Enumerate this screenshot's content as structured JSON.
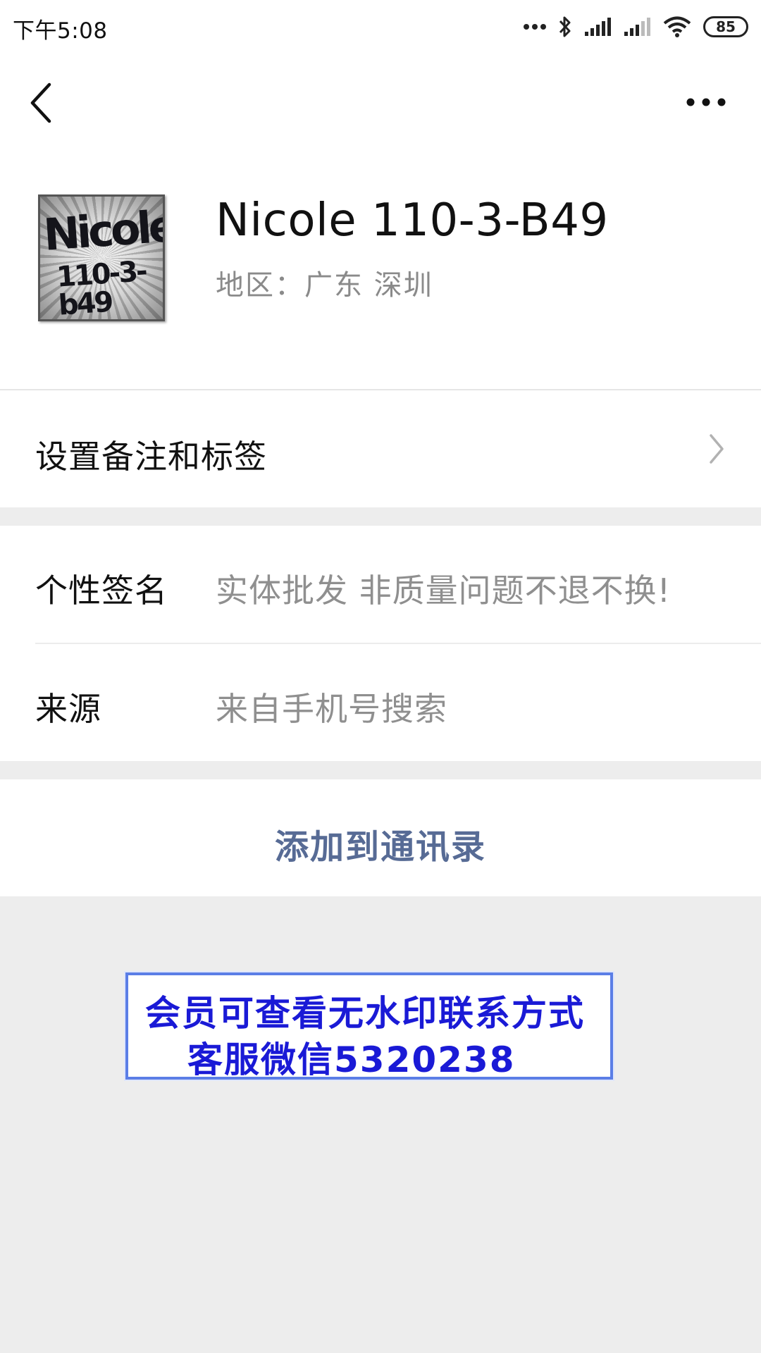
{
  "status_bar": {
    "time": "下午5:08",
    "battery": "85",
    "icons": [
      "dots-icon",
      "bluetooth-icon",
      "signal-icon",
      "signal-weak-icon",
      "wifi-icon",
      "battery-icon"
    ]
  },
  "nav": {
    "back_icon": "chevron-left-icon",
    "more_icon": "more-dots-icon"
  },
  "profile": {
    "avatar_text_line1": "Nicole",
    "avatar_text_line2": "110-3-b49",
    "name": "Nicole 110-3-B49",
    "region": "地区：广东  深圳"
  },
  "rows": {
    "remark_label": "设置备注和标签",
    "signature_label": "个性签名",
    "signature_value": "实体批发 非质量问题不退不换!",
    "source_label": "来源",
    "source_value": "来自手机号搜索"
  },
  "actions": {
    "add_contact": "添加到通讯录"
  },
  "watermark": {
    "line1": "会员可查看无水印联系方式",
    "line2": "客服微信5320238"
  },
  "colors": {
    "link": "#576b95",
    "watermark_text": "#1a1ad6",
    "watermark_border": "#5b7ee6",
    "background": "#ededed"
  }
}
